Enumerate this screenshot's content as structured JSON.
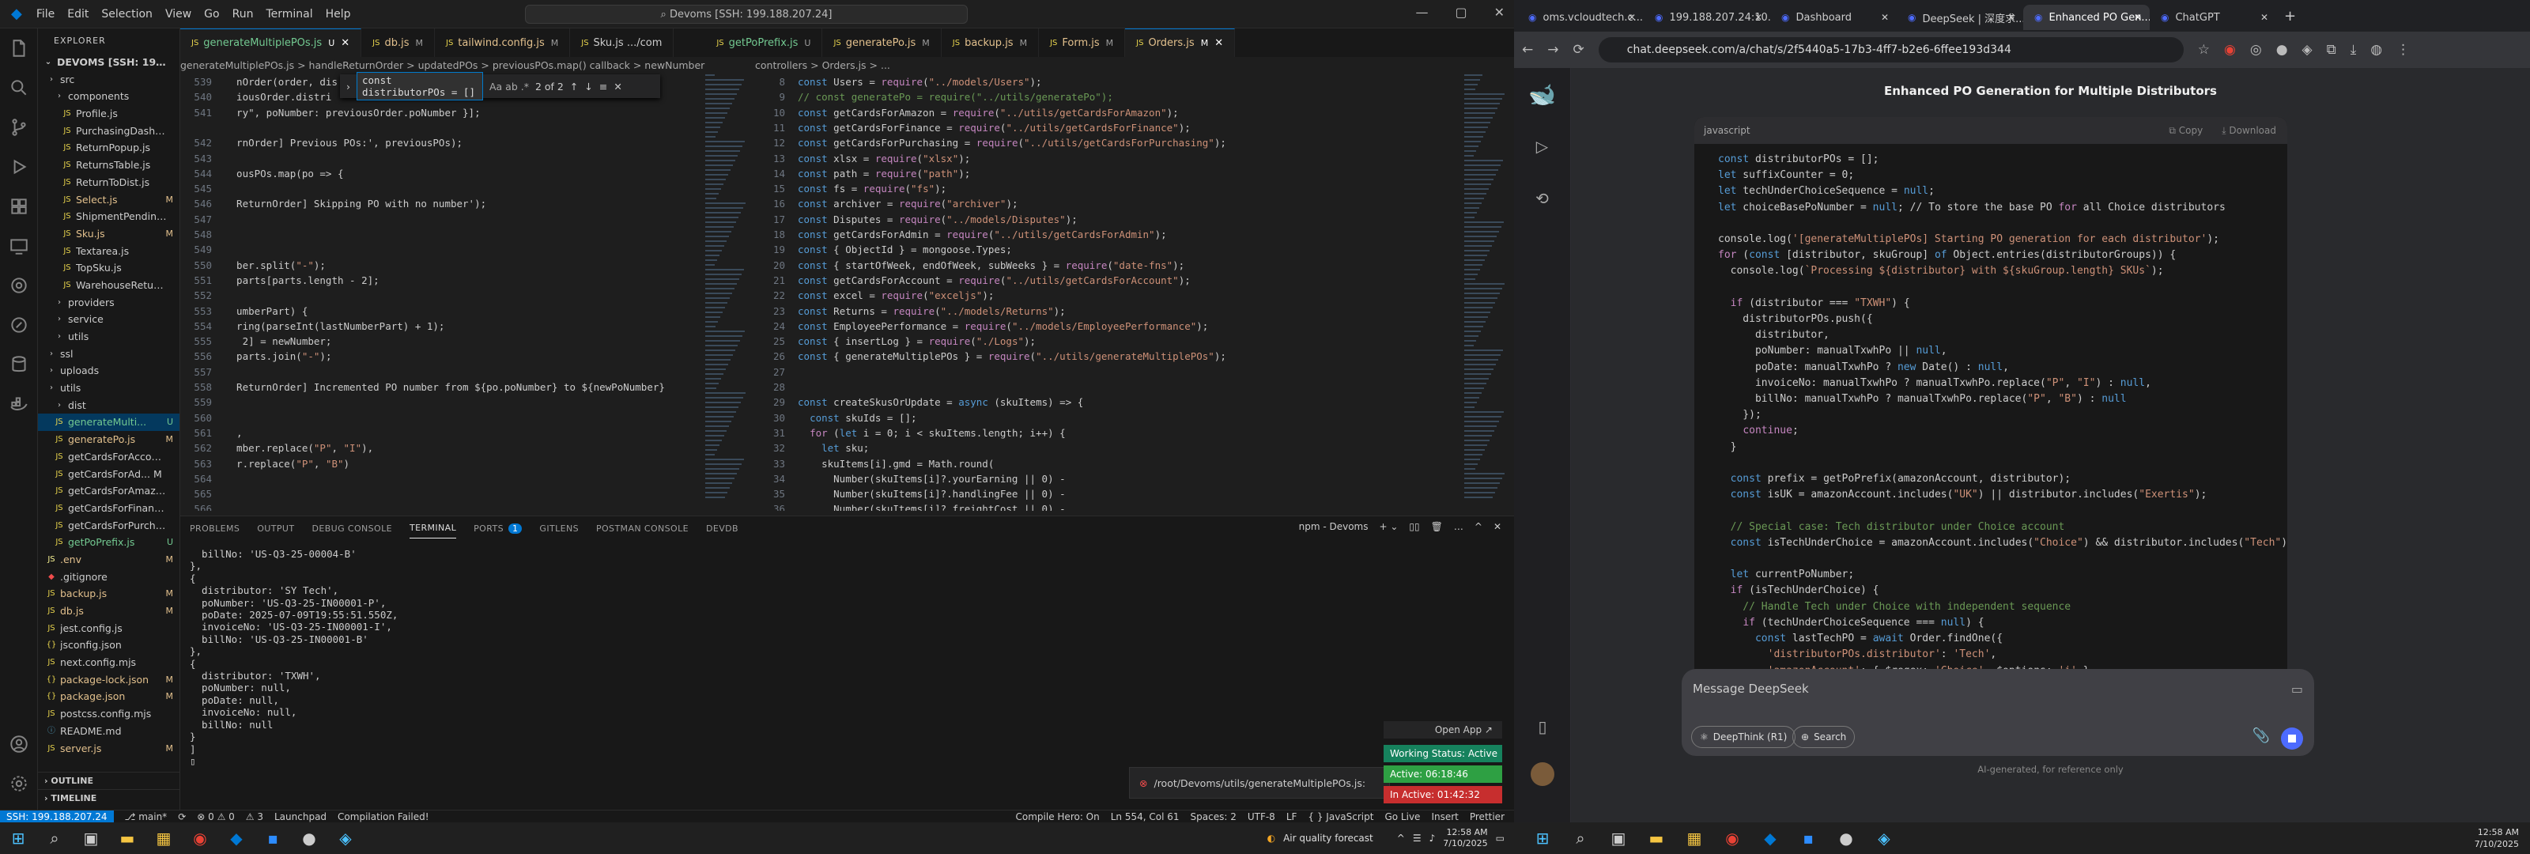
{
  "vscode": {
    "menu": [
      "File",
      "Edit",
      "Selection",
      "View",
      "Go",
      "Run",
      "Terminal",
      "Help"
    ],
    "command_center": "Devoms [SSH: 199.188.207.24]",
    "explorer_title": "EXPLORER",
    "workspace": "DEVOMS [SSH: 199.188.20...",
    "tree": [
      {
        "name": "src",
        "indent": 1,
        "type": "folder",
        "status": ""
      },
      {
        "name": "components",
        "indent": 2,
        "type": "folder",
        "status": ""
      },
      {
        "name": "Profile.js",
        "indent": 3,
        "type": "js",
        "status": ""
      },
      {
        "name": "PurchasingDashbo...",
        "indent": 3,
        "type": "js",
        "status": ""
      },
      {
        "name": "ReturnPopup.js",
        "indent": 3,
        "type": "js",
        "status": ""
      },
      {
        "name": "ReturnsTable.js",
        "indent": 3,
        "type": "js",
        "status": ""
      },
      {
        "name": "ReturnToDist.js",
        "indent": 3,
        "type": "js",
        "status": ""
      },
      {
        "name": "Select.js",
        "indent": 3,
        "type": "js",
        "status": "M"
      },
      {
        "name": "ShipmentPending...",
        "indent": 3,
        "type": "js",
        "status": ""
      },
      {
        "name": "Sku.js",
        "indent": 3,
        "type": "js",
        "status": "M"
      },
      {
        "name": "Textarea.js",
        "indent": 3,
        "type": "js",
        "status": ""
      },
      {
        "name": "TopSku.js",
        "indent": 3,
        "type": "js",
        "status": ""
      },
      {
        "name": "WarehouseReturn.js",
        "indent": 3,
        "type": "js",
        "status": ""
      },
      {
        "name": "providers",
        "indent": 2,
        "type": "folder",
        "status": ""
      },
      {
        "name": "service",
        "indent": 2,
        "type": "folder",
        "status": ""
      },
      {
        "name": "utils",
        "indent": 2,
        "type": "folder",
        "status": ""
      },
      {
        "name": "ssl",
        "indent": 1,
        "type": "folder",
        "status": ""
      },
      {
        "name": "uploads",
        "indent": 1,
        "type": "folder",
        "status": ""
      },
      {
        "name": "utils",
        "indent": 1,
        "type": "folder",
        "status": ""
      },
      {
        "name": "dist",
        "indent": 2,
        "type": "folder",
        "status": ""
      },
      {
        "name": "generateMulti...",
        "indent": 2,
        "type": "js",
        "status": "U",
        "selected": true
      },
      {
        "name": "generatePo.js",
        "indent": 2,
        "type": "js",
        "status": "M"
      },
      {
        "name": "getCardsForAccount.js",
        "indent": 2,
        "type": "js",
        "status": ""
      },
      {
        "name": "getCardsForAd... M",
        "indent": 2,
        "type": "js",
        "status": ""
      },
      {
        "name": "getCardsForAmazon.js",
        "indent": 2,
        "type": "js",
        "status": ""
      },
      {
        "name": "getCardsForFinance.js",
        "indent": 2,
        "type": "js",
        "status": ""
      },
      {
        "name": "getCardsForPurchasi...",
        "indent": 2,
        "type": "js",
        "status": ""
      },
      {
        "name": "getPoPrefix.js",
        "indent": 2,
        "type": "js",
        "status": "U"
      },
      {
        "name": ".env",
        "indent": 1,
        "type": "env",
        "status": "M"
      },
      {
        "name": ".gitignore",
        "indent": 1,
        "type": "git",
        "status": ""
      },
      {
        "name": "backup.js",
        "indent": 1,
        "type": "js",
        "status": "M"
      },
      {
        "name": "db.js",
        "indent": 1,
        "type": "js",
        "status": "M"
      },
      {
        "name": "jest.config.js",
        "indent": 1,
        "type": "js",
        "status": ""
      },
      {
        "name": "jsconfig.json",
        "indent": 1,
        "type": "json",
        "status": ""
      },
      {
        "name": "next.config.mjs",
        "indent": 1,
        "type": "js",
        "status": ""
      },
      {
        "name": "package-lock.json",
        "indent": 1,
        "type": "json",
        "status": "M"
      },
      {
        "name": "package.json",
        "indent": 1,
        "type": "json",
        "status": "M"
      },
      {
        "name": "postcss.config.mjs",
        "indent": 1,
        "type": "js",
        "status": ""
      },
      {
        "name": "README.md",
        "indent": 1,
        "type": "md",
        "status": ""
      },
      {
        "name": "server.js",
        "indent": 1,
        "type": "js",
        "status": "M"
      }
    ],
    "outline": "OUTLINE",
    "timeline": "TIMELINE",
    "tabs": [
      {
        "label": "generateMultiplePOs.js",
        "mod": "U",
        "active": true
      },
      {
        "label": "db.js",
        "mod": "M",
        "active": false
      },
      {
        "label": "tailwind.config.js",
        "mod": "M",
        "active": false
      },
      {
        "label": "Sku.js .../com",
        "mod": "",
        "active": false
      },
      {
        "label": "getPoPrefix.js",
        "mod": "U",
        "active": false
      },
      {
        "label": "generatePo.js",
        "mod": "M",
        "active": false
      },
      {
        "label": "backup.js",
        "mod": "M",
        "active": false
      },
      {
        "label": "Form.js",
        "mod": "M",
        "active": false
      },
      {
        "label": "Orders.js",
        "mod": "M",
        "active": true
      }
    ],
    "breadcrumb_left": "generateMultiplePOs.js > handleReturnOrder > updatedPOs > previousPOs.map() callback > newNumber",
    "breadcrumb_right": "controllers > Orders.js > ...",
    "find": {
      "value": "const distributorPOs = []",
      "count": "2 of 2",
      "opts": "Aa  ab  .*"
    },
    "left_lines": [
      {
        "n": "539",
        "code": "  nOrder(order, dis"
      },
      {
        "n": "540",
        "code": "  iousOrder.distri"
      },
      {
        "n": "541",
        "code": "  ry\", poNumber: previousOrder.poNumber }];"
      },
      {
        "n": "",
        "code": ""
      },
      {
        "n": "542",
        "code": "  rnOrder] Previous POs:', previousPOs);"
      },
      {
        "n": "543",
        "code": ""
      },
      {
        "n": "544",
        "code": "  ousPOs.map(po => {"
      },
      {
        "n": "545",
        "code": ""
      },
      {
        "n": "546",
        "code": "  ReturnOrder] Skipping PO with no number');"
      },
      {
        "n": "547",
        "code": ""
      },
      {
        "n": "548",
        "code": ""
      },
      {
        "n": "549",
        "code": ""
      },
      {
        "n": "550",
        "code": "  ber.split(\"-\");"
      },
      {
        "n": "551",
        "code": "  parts[parts.length - 2];"
      },
      {
        "n": "552",
        "code": ""
      },
      {
        "n": "553",
        "code": "  umberPart) {"
      },
      {
        "n": "554",
        "code": "  ring(parseInt(lastNumberPart) + 1);"
      },
      {
        "n": "555",
        "code": "   2] = newNumber;"
      },
      {
        "n": "556",
        "code": "  parts.join(\"-\");"
      },
      {
        "n": "557",
        "code": ""
      },
      {
        "n": "558",
        "code": "  ReturnOrder] Incremented PO number from ${po.poNumber} to ${newPoNumber}"
      },
      {
        "n": "559",
        "code": ""
      },
      {
        "n": "560",
        "code": ""
      },
      {
        "n": "561",
        "code": "  ,"
      },
      {
        "n": "562",
        "code": "  mber.replace(\"P\", \"I\"),"
      },
      {
        "n": "563",
        "code": "  r.replace(\"P\", \"B\")"
      },
      {
        "n": "564",
        "code": ""
      },
      {
        "n": "565",
        "code": ""
      },
      {
        "n": "566",
        "code": ""
      }
    ],
    "right_lines": [
      {
        "n": "8",
        "code": "const Users = require(\"../models/Users\");"
      },
      {
        "n": "9",
        "code": "// const generatePo = require(\"../utils/generatePo\");"
      },
      {
        "n": "10",
        "code": "const getCardsForAmazon = require(\"../utils/getCardsForAmazon\");"
      },
      {
        "n": "11",
        "code": "const getCardsForFinance = require(\"../utils/getCardsForFinance\");"
      },
      {
        "n": "12",
        "code": "const getCardsForPurchasing = require(\"../utils/getCardsForPurchasing\");"
      },
      {
        "n": "13",
        "code": "const xlsx = require(\"xlsx\");"
      },
      {
        "n": "14",
        "code": "const path = require(\"path\");"
      },
      {
        "n": "15",
        "code": "const fs = require(\"fs\");"
      },
      {
        "n": "16",
        "code": "const archiver = require(\"archiver\");"
      },
      {
        "n": "17",
        "code": "const Disputes = require(\"../models/Disputes\");"
      },
      {
        "n": "18",
        "code": "const getCardsForAdmin = require(\"../utils/getCardsForAdmin\");"
      },
      {
        "n": "19",
        "code": "const { ObjectId } = mongoose.Types;"
      },
      {
        "n": "20",
        "code": "const { startOfWeek, endOfWeek, subWeeks } = require(\"date-fns\");"
      },
      {
        "n": "21",
        "code": "const getCardsForAccount = require(\"../utils/getCardsForAccount\");"
      },
      {
        "n": "22",
        "code": "const excel = require(\"exceljs\");"
      },
      {
        "n": "23",
        "code": "const Returns = require(\"../models/Returns\");"
      },
      {
        "n": "24",
        "code": "const EmployeePerformance = require(\"../models/EmployeePerformance\");"
      },
      {
        "n": "25",
        "code": "const { insertLog } = require(\"./Logs\");"
      },
      {
        "n": "26",
        "code": "const { generateMultiplePOs } = require(\"../utils/generateMultiplePOs\");"
      },
      {
        "n": "27",
        "code": ""
      },
      {
        "n": "28",
        "code": ""
      },
      {
        "n": "29",
        "code": "const createSkusOrUpdate = async (skuItems) => {"
      },
      {
        "n": "30",
        "code": "  const skuIds = [];"
      },
      {
        "n": "31",
        "code": "  for (let i = 0; i < skuItems.length; i++) {"
      },
      {
        "n": "32",
        "code": "    let sku;"
      },
      {
        "n": "33",
        "code": "    skuItems[i].gmd = Math.round("
      },
      {
        "n": "34",
        "code": "      Number(skuItems[i]?.yourEarning || 0) -"
      },
      {
        "n": "35",
        "code": "      Number(skuItems[i]?.handlingFee || 0) -"
      },
      {
        "n": "36",
        "code": "      Number(skuItems[i]?.freightCost || 0) -"
      }
    ],
    "panel_tabs": [
      "PROBLEMS",
      "OUTPUT",
      "DEBUG CONSOLE",
      "TERMINAL",
      "PORTS",
      "GITLENS",
      "POSTMAN CONSOLE",
      "DEVDB"
    ],
    "ports_count": "1",
    "terminal_name": "npm - Devoms",
    "terminal_lines": [
      "  billNo: 'US-Q3-25-00004-B'",
      "},",
      "{",
      "  distributor: 'SY Tech',",
      "  poNumber: 'US-Q3-25-IN00001-P',",
      "  poDate: 2025-07-09T19:55:51.550Z,",
      "  invoiceNo: 'US-Q3-25-IN00001-I',",
      "  billNo: 'US-Q3-25-IN00001-B'",
      "},",
      "{",
      "  distributor: 'TXWH',",
      "  poNumber: null,",
      "  poDate: null,",
      "  invoiceNo: null,",
      "  billNo: null",
      "}",
      "]",
      "▯"
    ],
    "notification": "/root/Devoms/utils/generateMultiplePOs.js:",
    "open_app": "Open App ↗",
    "working_status": "Working Status: Active",
    "active_time": "Active: 06:18:46",
    "inactive_time": "In Active: 01:42:32",
    "status": {
      "remote": "SSH: 199.188.207.24",
      "branch": "main*",
      "errors": "⊗ 0 ⚠ 0",
      "warn": "⚠ 3",
      "launchpad": "Launchpad",
      "compile": "Compilation Failed!",
      "hero": "Compile Hero: On",
      "pos": "Ln 554, Col 61",
      "spaces": "Spaces: 2",
      "enc": "UTF-8",
      "eol": "LF",
      "lang": "{ } JavaScript",
      "live": "Go Live",
      "insert": "Insert",
      "prettier": "Prettier"
    }
  },
  "taskbar_left": {
    "weather": "Air quality forecast",
    "time": "12:58 AM",
    "date": "7/10/2025"
  },
  "browser": {
    "tabs": [
      {
        "label": "oms.vcloudtech.c...",
        "active": false
      },
      {
        "label": "199.188.207.24:10...",
        "active": false
      },
      {
        "label": "Dashboard",
        "active": false
      },
      {
        "label": "DeepSeek | 深度求...",
        "active": false
      },
      {
        "label": "Enhanced PO Gen...",
        "active": true
      },
      {
        "label": "ChatGPT",
        "active": false
      }
    ],
    "url": "chat.deepseek.com/a/chat/s/2f5440a5-17b3-4ff7-b2e6-6ffee193d344",
    "title": "Enhanced PO Generation for Multiple Distributors",
    "code_lang": "javascript",
    "copy": "Copy",
    "download": "Download",
    "code": [
      "const distributorPOs = [];",
      "let suffixCounter = 0;",
      "let techUnderChoiceSequence = null;",
      "let choiceBasePoNumber = null; // To store the base PO for all Choice distributors",
      "",
      "console.log('[generateMultiplePOs] Starting PO generation for each distributor');",
      "for (const [distributor, skuGroup] of Object.entries(distributorGroups)) {",
      "  console.log(`Processing ${distributor} with ${skuGroup.length} SKUs`);",
      "",
      "  if (distributor === \"TXWH\") {",
      "    distributorPOs.push({",
      "      distributor,",
      "      poNumber: manualTxwhPo || null,",
      "      poDate: manualTxwhPo ? new Date() : null,",
      "      invoiceNo: manualTxwhPo ? manualTxwhPo.replace(\"P\", \"I\") : null,",
      "      billNo: manualTxwhPo ? manualTxwhPo.replace(\"P\", \"B\") : null",
      "    });",
      "    continue;",
      "  }",
      "",
      "  const prefix = getPoPrefix(amazonAccount, distributor);",
      "  const isUK = amazonAccount.includes(\"UK\") || distributor.includes(\"Exertis\");",
      "",
      "  // Special case: Tech distributor under Choice account",
      "  const isTechUnderChoice = amazonAccount.includes(\"Choice\") && distributor.includes(\"Tech\");",
      "",
      "  let currentPoNumber;",
      "  if (isTechUnderChoice) {",
      "    // Handle Tech under Choice with independent sequence",
      "    if (techUnderChoiceSequence === null) {",
      "      const lastTechPO = await Order.findOne({",
      "        'distributorPOs.distributor': 'Tech',",
      "        'amazonAccount': { $regex: 'Choice', $options: 'i' },"
    ],
    "placeholder": "Message DeepSeek",
    "deepthink": "DeepThink (R1)",
    "search": "Search",
    "disclaimer": "AI-generated, for reference only"
  },
  "taskbar_right": {
    "time": "12:58 AM",
    "date": "7/10/2025"
  }
}
